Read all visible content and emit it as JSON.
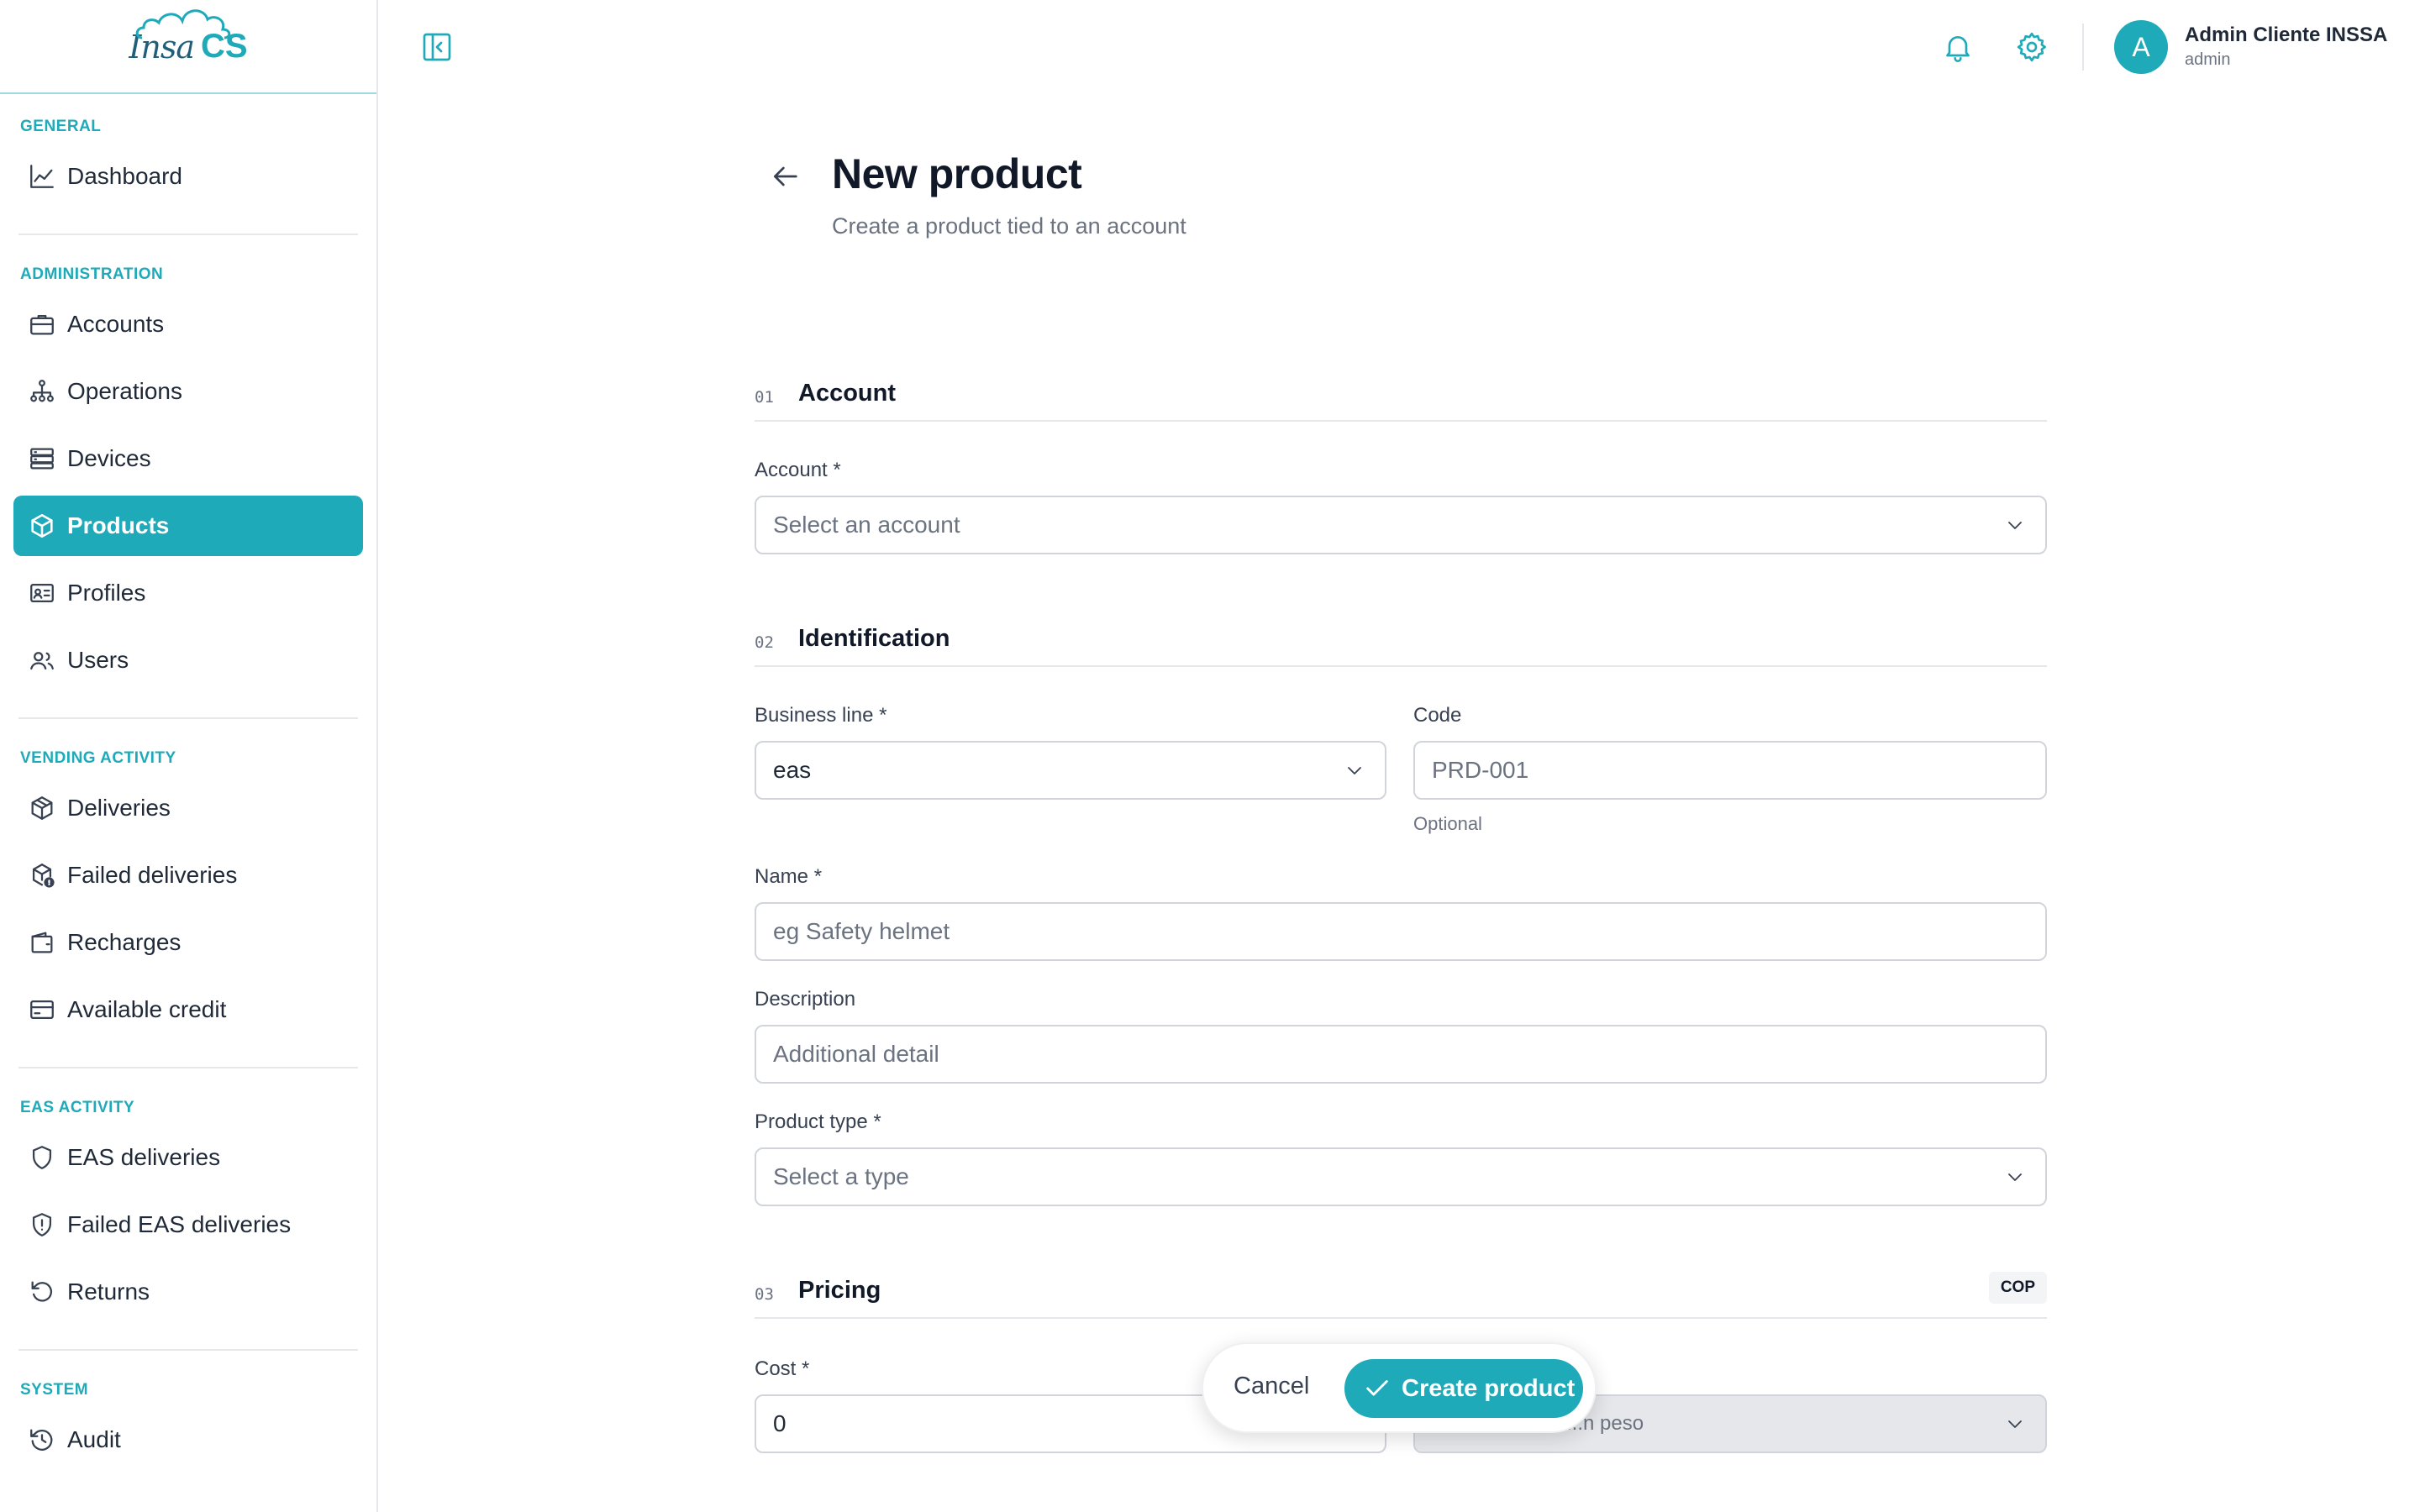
{
  "brand": {
    "logo_text_left": "Insa",
    "logo_text_right": "CS",
    "accent": "#1eaab9"
  },
  "sidebar": {
    "sections": [
      {
        "title": "GENERAL"
      },
      {
        "title": "ADMINISTRATION"
      },
      {
        "title": "VENDING ACTIVITY"
      },
      {
        "title": "EAS ACTIVITY"
      },
      {
        "title": "SYSTEM"
      }
    ],
    "items": [
      {
        "label": "Dashboard",
        "icon": "chart-line-icon"
      },
      {
        "label": "Accounts",
        "icon": "briefcase-icon"
      },
      {
        "label": "Operations",
        "icon": "org-chart-icon"
      },
      {
        "label": "Devices",
        "icon": "server-icon"
      },
      {
        "label": "Products",
        "icon": "box-icon",
        "active": true
      },
      {
        "label": "Profiles",
        "icon": "id-card-icon"
      },
      {
        "label": "Users",
        "icon": "users-icon"
      },
      {
        "label": "Deliveries",
        "icon": "package-icon"
      },
      {
        "label": "Failed deliveries",
        "icon": "package-alert-icon"
      },
      {
        "label": "Recharges",
        "icon": "wallet-icon"
      },
      {
        "label": "Available credit",
        "icon": "credit-card-icon"
      },
      {
        "label": "EAS deliveries",
        "icon": "shield-icon"
      },
      {
        "label": "Failed EAS deliveries",
        "icon": "shield-alert-icon"
      },
      {
        "label": "Returns",
        "icon": "rotate-ccw-icon"
      },
      {
        "label": "Audit",
        "icon": "history-icon"
      }
    ]
  },
  "header": {
    "user_initial": "A",
    "user_name": "Admin Cliente INSSA",
    "user_role": "admin"
  },
  "page": {
    "title": "New product",
    "subtitle": "Create a product tied to an account"
  },
  "sections": {
    "account": {
      "num": "01",
      "title": "Account"
    },
    "identification": {
      "num": "02",
      "title": "Identification"
    },
    "pricing": {
      "num": "03",
      "title": "Pricing",
      "currency": "COP"
    }
  },
  "form": {
    "account": {
      "label": "Account *",
      "placeholder": "Select an account"
    },
    "business_line": {
      "label": "Business line *",
      "value": "eas"
    },
    "code": {
      "label": "Code",
      "placeholder": "PRD-001",
      "hint": "Optional"
    },
    "name": {
      "label": "Name *",
      "placeholder": "eg Safety helmet"
    },
    "description": {
      "label": "Description",
      "placeholder": "Additional detail"
    },
    "product_type": {
      "label": "Product type *",
      "placeholder": "Select a type"
    },
    "cost": {
      "label": "Cost *",
      "value": "0"
    },
    "currency": {
      "partial_value": "...n peso"
    }
  },
  "actions": {
    "cancel": "Cancel",
    "create": "Create product"
  }
}
